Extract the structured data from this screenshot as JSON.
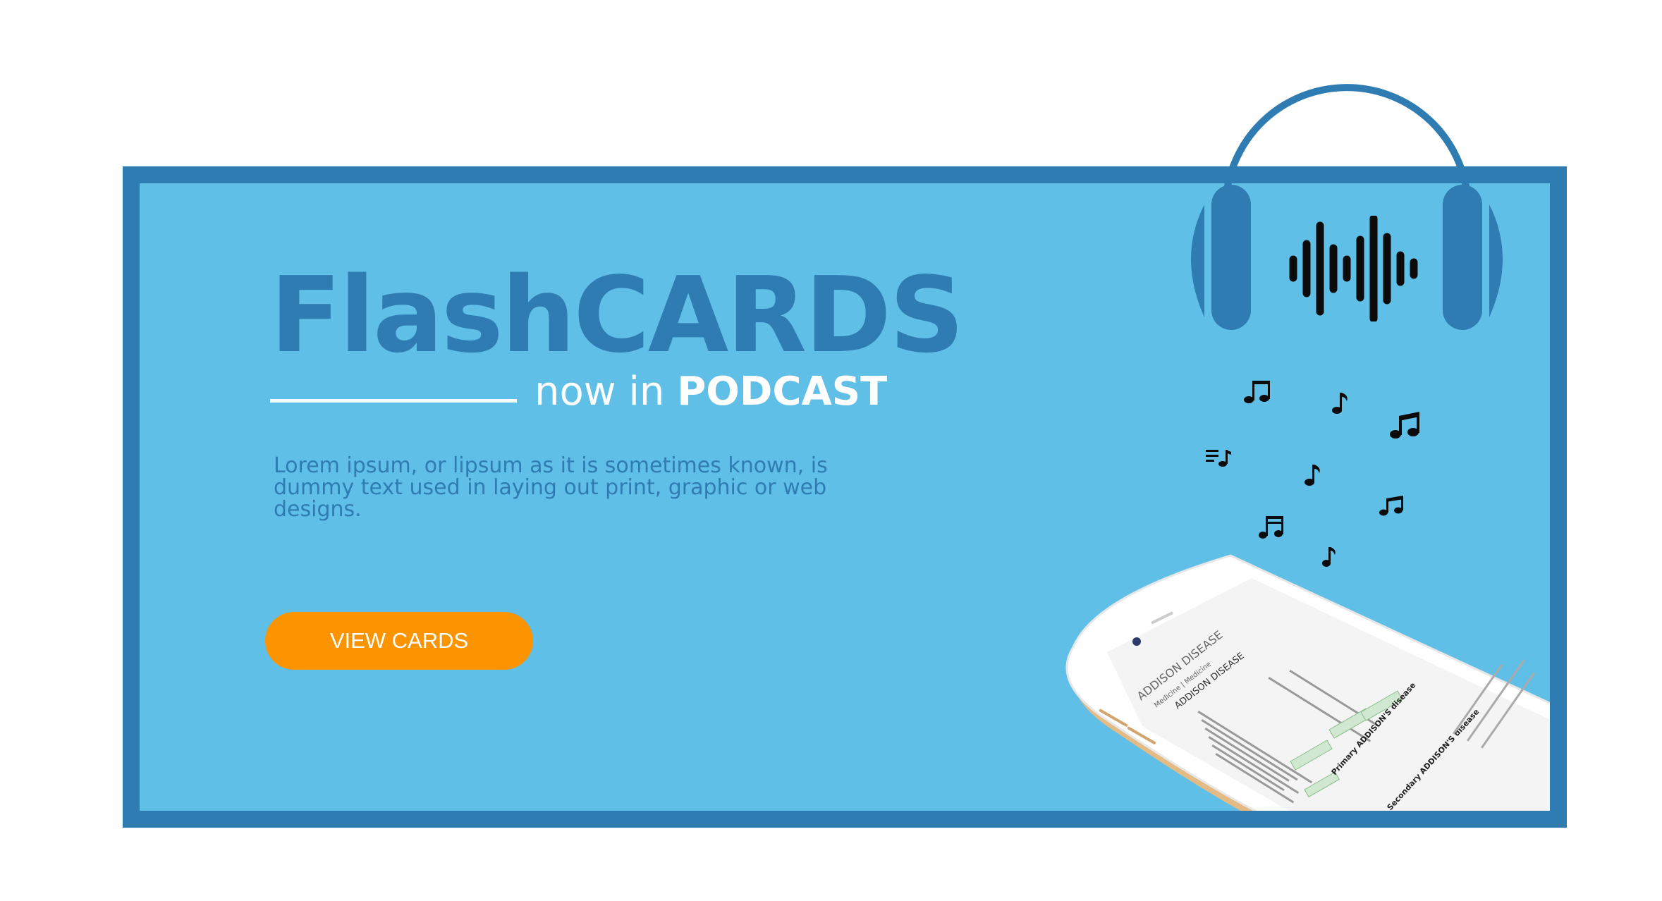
{
  "banner": {
    "title": "FlashCARDS",
    "subtitle_prefix": "now in",
    "subtitle_emphasis": "PODCAST",
    "description": "Lorem ipsum, or lipsum as it is sometimes known, is dummy text used in laying out print, graphic or web designs.",
    "cta_label": "VIEW CARDS"
  },
  "colors": {
    "frame": "#2f7cb2",
    "background": "#5fbfe7",
    "title": "#2f7cb2",
    "cta": "#fc9400",
    "white": "#ffffff"
  },
  "phone_screen": {
    "heading": "ADDISON DISEASE",
    "breadcrumb": "Medicine | Medicine",
    "section_primary": "Primary ADDISON'S disease",
    "section_secondary": "Secondary ADDISON'S disease"
  },
  "icons": [
    "headphones-icon",
    "soundwave-icon",
    "music-note-icon",
    "smartphone-illustration"
  ]
}
